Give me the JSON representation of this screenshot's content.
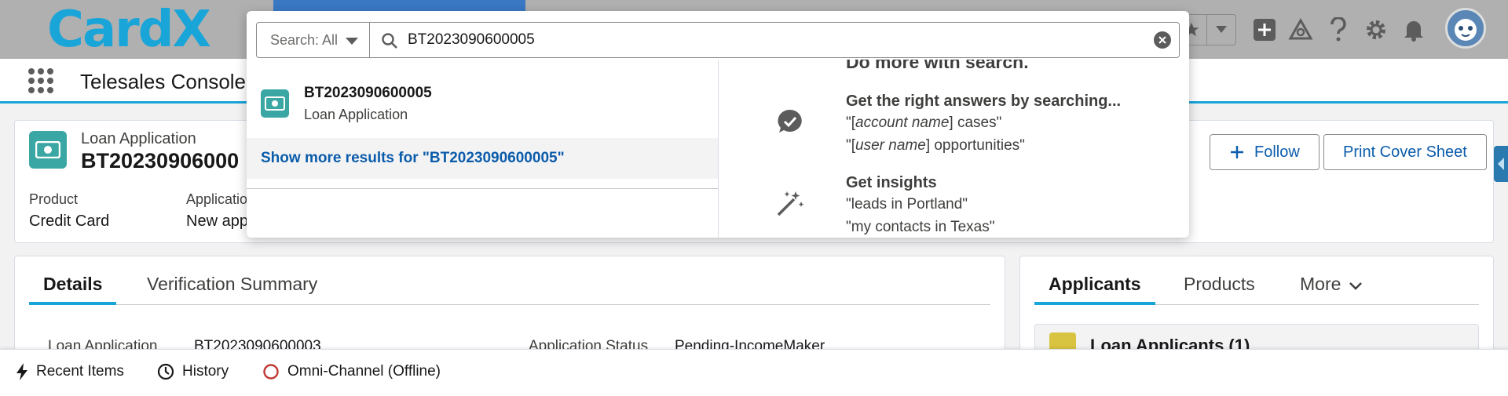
{
  "header": {
    "logo_text": "CardX",
    "icons": [
      "favorites-star-icon",
      "favorites-menu-icon",
      "add-icon",
      "trailhead-icon",
      "help-icon",
      "setup-gear-icon",
      "notifications-bell-icon",
      "user-avatar"
    ]
  },
  "app_nav": {
    "app_name": "Telesales Console"
  },
  "record": {
    "object_type": "Loan Application",
    "name": "BT20230906000",
    "fields": [
      {
        "label": "Product",
        "value": "Credit Card"
      },
      {
        "label": "Applicatio",
        "value": "New app"
      }
    ],
    "buttons": {
      "follow": "Follow",
      "print": "Print Cover Sheet"
    }
  },
  "details": {
    "tabs": [
      "Details",
      "Verification Summary"
    ],
    "row": {
      "label1": "Loan Application",
      "value1": "BT2023090600003",
      "label2": "Application Status",
      "value2": "Pending-IncomeMaker"
    }
  },
  "related": {
    "tabs": [
      "Applicants",
      "Products",
      "More"
    ],
    "list_title": "Loan Applicants (1)"
  },
  "utility_bar": {
    "items": [
      "Recent Items",
      "History",
      "Omni-Channel (Offline)"
    ]
  },
  "search": {
    "scope": "Search: All",
    "query": "BT2023090600005",
    "result": {
      "name": "BT2023090600005",
      "type": "Loan Application"
    },
    "show_more": "Show more results for \"BT2023090600005\"",
    "tips_heading": "Do more with search.",
    "tip1": {
      "title": "Get the right answers by searching...",
      "line1_pre": "\"[",
      "line1_em": "account name",
      "line1_post": "] cases\"",
      "line2_pre": "\"[",
      "line2_em": "user name",
      "line2_post": "] opportunities\""
    },
    "tip2": {
      "title": "Get insights",
      "line1": "\"leads in Portland\"",
      "line2": "\"my contacts in Texas\""
    }
  },
  "colors": {
    "brand_blue": "#1aa5d9",
    "link_blue": "#0b5cab",
    "record_icon_teal": "#3ba7a4",
    "header_gray": "#b0b0b0",
    "omni_offline_red": "#c23934"
  }
}
